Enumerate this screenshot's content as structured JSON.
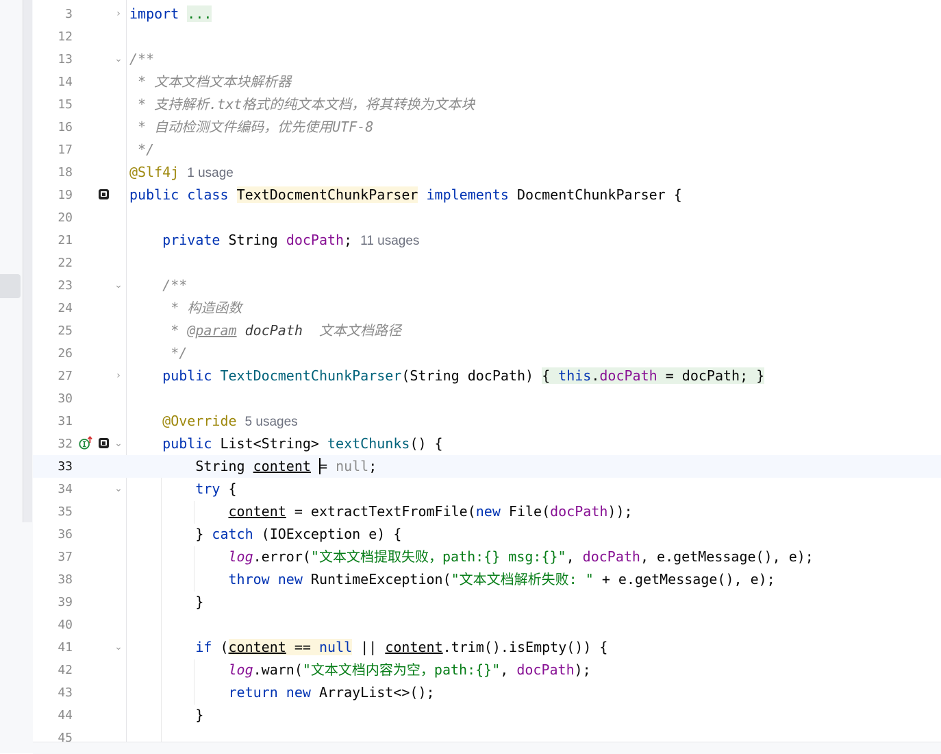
{
  "editor": {
    "file_class": "TextDocmentChunkParser",
    "interface": "DocmentChunkParser",
    "hints": {
      "slf4j_usage": "1 usage",
      "docpath_usages": "11 usages",
      "override_usages": "5 usages"
    },
    "line_numbers": [
      "3",
      "12",
      "13",
      "14",
      "15",
      "16",
      "17",
      "18",
      "19",
      "20",
      "21",
      "22",
      "23",
      "24",
      "25",
      "26",
      "27",
      "30",
      "31",
      "32",
      "33",
      "34",
      "35",
      "36",
      "37",
      "38",
      "39",
      "40",
      "41",
      "42",
      "43",
      "44",
      "45"
    ],
    "current_line": "33",
    "text": {
      "import": "import",
      "folded": "...",
      "doc_open": "/**",
      "doc_star": "*",
      "doc_close": "*/",
      "doc1": "文本文档文本块解析器",
      "doc2": "支持解析.txt格式的纯文本文档，将其转换为文本块",
      "doc3": "自动检测文件编码，优先使用UTF-8",
      "slf4j": "@Slf4j",
      "public": "public",
      "class": "class",
      "implements": "implements",
      "brace_open": "{",
      "brace_close": "}",
      "private": "private",
      "string": "String",
      "docPath": "docPath",
      "semicolon": ";",
      "ctor_doc": "构造函数",
      "param_tag": "@param",
      "param_desc": "文本文档路径",
      "ctor_sig_rest": "(String docPath)",
      "this": "this",
      "dot": ".",
      "assign_rest": " = docPath;",
      "override": "@Override",
      "list_type": "List<String>",
      "method_name": "textChunks",
      "method_rest": "() {",
      "content": "content",
      "assign": "=",
      "null": "null",
      "try": "try",
      "extract_rest": " = extractTextFromFile(",
      "new": "new",
      "file_open": " File(",
      "close_paren2": "));",
      "catch": "catch",
      "catch_rest": " (IOException e) {",
      "log": "log",
      "error_call": ".error(",
      "error_str": "\"文本文档提取失败，path:{} msg:{}\"",
      "comma_sp": ", ",
      "error_tail": ", e.getMessage(), e);",
      "throw": "throw",
      "runtime": " RuntimeException(",
      "throw_str": "\"文本文档解析失败: \"",
      "throw_tail": " + e.getMessage(), e);",
      "if": "if",
      "eq_null_pre": " == ",
      "or": " || ",
      "trim_rest": ".trim().isEmpty()) {",
      "warn_call": ".warn(",
      "warn_str": "\"文本文档内容为空，path:{}\"",
      "warn_tail": ");",
      "return": "return",
      "arraylist": " ArrayList<>();"
    }
  },
  "colors": {
    "keyword": "#0033b3",
    "field": "#871094",
    "comment": "#8c8c8c",
    "annotation": "#9e880d",
    "string": "#067d17",
    "method": "#00627a"
  }
}
